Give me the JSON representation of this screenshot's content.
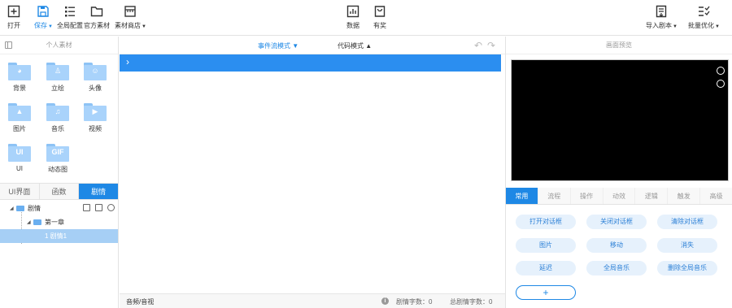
{
  "toolbar": {
    "open": "打开",
    "save": "保存",
    "global_config": "全局配置",
    "official_material": "官方素材",
    "material_store": "素材商店",
    "data": "数据",
    "publish": "有奖",
    "import_script": "导入剧本",
    "batch_optimize": "批量优化"
  },
  "left": {
    "title": "个人素材",
    "materials": [
      {
        "label": "背景",
        "icon": "palette-icon"
      },
      {
        "label": "立绘",
        "icon": "person-icon"
      },
      {
        "label": "头像",
        "icon": "avatar-icon"
      },
      {
        "label": "图片",
        "icon": "image-icon"
      },
      {
        "label": "音乐",
        "icon": "music-icon"
      },
      {
        "label": "视频",
        "icon": "video-icon"
      },
      {
        "label": "UI",
        "glyph": "UI"
      },
      {
        "label": "动态图",
        "glyph": "GIF"
      }
    ],
    "tabs": [
      "UI界面",
      "函数",
      "剧情"
    ],
    "tree": {
      "root": "剧情",
      "chapter": "第一章",
      "scene": "1 剧情1"
    }
  },
  "center": {
    "event_mode": "事件流模式",
    "code_mode": "代码模式",
    "footer_left": "音频/音视",
    "plot_chars": "剧情字数：0",
    "total_chars": "总剧情字数：0"
  },
  "right": {
    "title": "画面预览",
    "tabs": [
      "常用",
      "流程",
      "操作",
      "动效",
      "逻辑",
      "触发",
      "高级"
    ],
    "buttons": [
      "打开对话框",
      "关闭对话框",
      "清除对话框",
      "图片",
      "移动",
      "消失",
      "延迟",
      "全局音乐",
      "删除全局音乐"
    ],
    "add_label": "+"
  },
  "colors": {
    "accent": "#1e88e5",
    "folder": "#a9d3fb",
    "pill_bg": "#e6f1fc"
  }
}
